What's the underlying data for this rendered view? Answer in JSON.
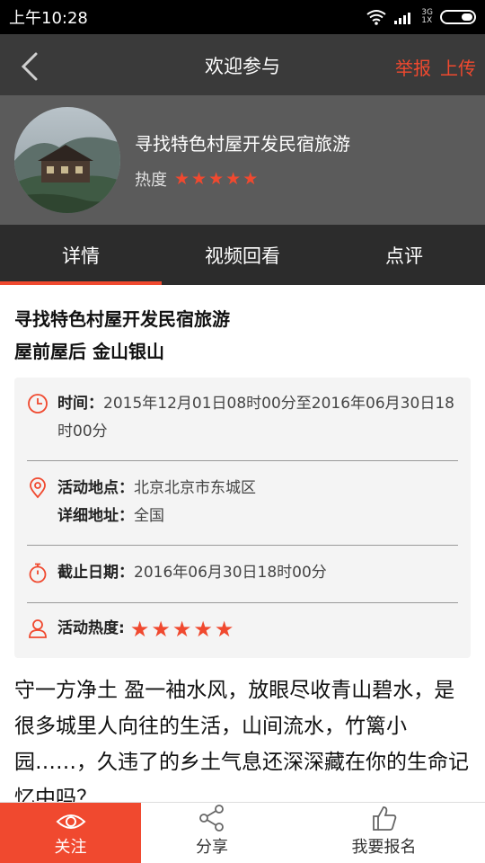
{
  "status_bar": {
    "time": "上午10:28",
    "network_top": "3G",
    "network_bottom": "1X"
  },
  "nav": {
    "title": "欢迎参与",
    "report_label": "举报",
    "upload_label": "上传"
  },
  "header": {
    "title": "寻找特色村屋开发民宿旅游",
    "heat_label": "热度",
    "heat_rating": 5,
    "heat_max": 5
  },
  "tabs": [
    {
      "label": "详情",
      "active": true
    },
    {
      "label": "视频回看",
      "active": false
    },
    {
      "label": "点评",
      "active": false
    }
  ],
  "content": {
    "title_line1": "寻找特色村屋开发民宿旅游",
    "title_line2": "屋前屋后 金山银山",
    "time_key": "时间：",
    "time_value": "2015年12月01日08时00分至2016年06月30日18时00分",
    "location_key": "活动地点：",
    "location_value": "北京北京市东城区",
    "address_key": "详细地址：",
    "address_value": "全国",
    "deadline_key": "截止日期：",
    "deadline_value": "2016年06月30日18时00分",
    "heat_key": "活动热度:",
    "heat_rating": 5,
    "description": "守一方净土 盈一袖水风，放眼尽收青山碧水，是很多城里人向往的生活，山间流水，竹篱小园……，久违了的乡土气息还深深藏在你的生命记忆中吗？"
  },
  "bottom_bar": {
    "follow_label": "关注",
    "share_label": "分享",
    "signup_label": "我要报名"
  },
  "colors": {
    "accent": "#f0492f",
    "nav_bg": "#3a3a3a",
    "header_bg": "#5b5b5b",
    "tab_bg": "#2c2c2c"
  },
  "icons": [
    "back-arrow-icon",
    "wifi-icon",
    "signal-icon",
    "battery-icon",
    "clock-icon",
    "location-pin-icon",
    "stopwatch-icon",
    "person-icon",
    "eye-icon",
    "share-icon",
    "thumbs-up-icon",
    "star-icon"
  ]
}
